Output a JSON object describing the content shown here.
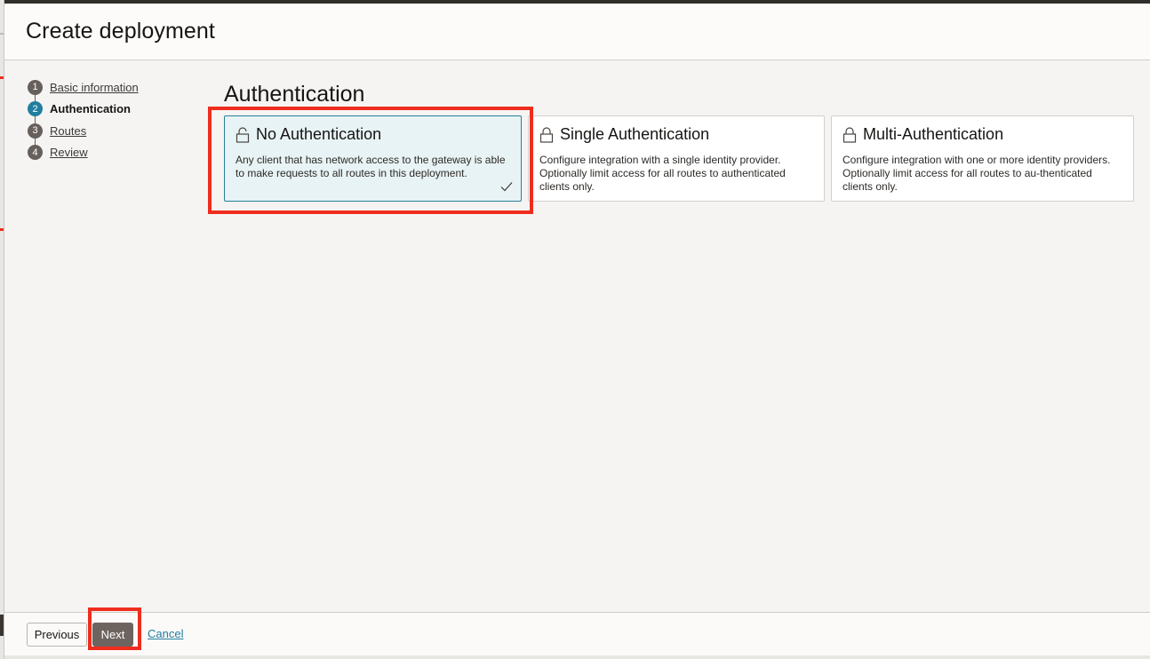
{
  "dialog": {
    "title": "Create deployment"
  },
  "steps": [
    {
      "number": "1",
      "label": "Basic information",
      "state": "link"
    },
    {
      "number": "2",
      "label": "Authentication",
      "state": "active"
    },
    {
      "number": "3",
      "label": "Routes",
      "state": "link"
    },
    {
      "number": "4",
      "label": "Review",
      "state": "link"
    }
  ],
  "section": {
    "title": "Authentication"
  },
  "auth_options": [
    {
      "title": "No Authentication",
      "description": "Any client that has network access to the gateway is able to make requests to all routes in this deployment.",
      "icon": "unlock-icon",
      "selected": true
    },
    {
      "title": "Single Authentication",
      "description": "Configure integration with a single identity provider. Optionally limit access for all routes to authenticated clients only.",
      "icon": "lock-icon",
      "selected": false
    },
    {
      "title": "Multi-Authentication",
      "description": "Configure integration with one or more identity providers. Optionally limit access for all routes to au-thenticated clients only.",
      "icon": "lock-icon",
      "selected": false
    }
  ],
  "footer": {
    "previous_label": "Previous",
    "next_label": "Next",
    "cancel_label": "Cancel"
  },
  "colors": {
    "accent": "#227e9e",
    "highlight": "#ef2d1e",
    "selected_card_bg": "#e8f3f5",
    "primary_button": "#6d6460"
  }
}
